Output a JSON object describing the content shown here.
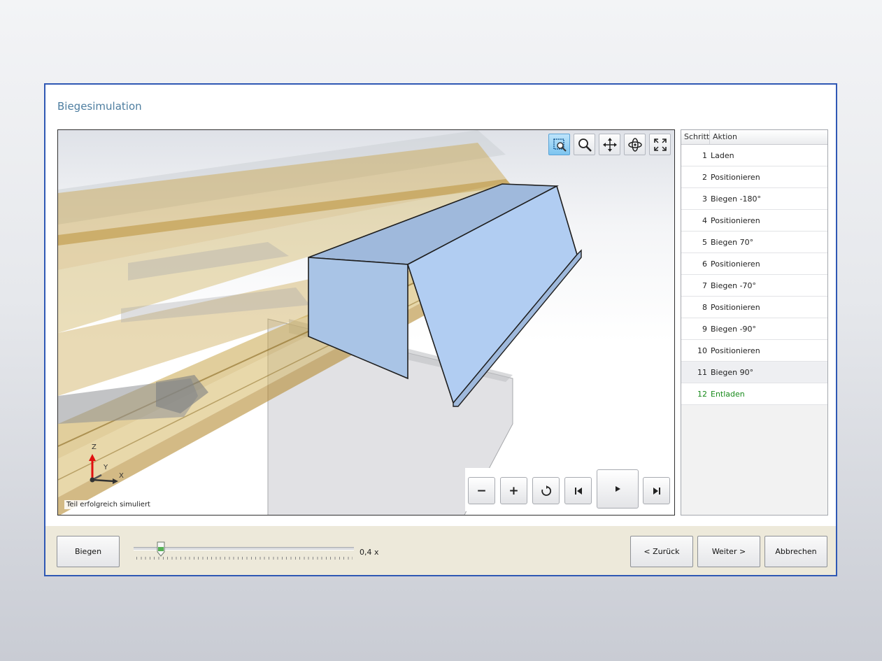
{
  "dialog": {
    "title": "Biegesimulation"
  },
  "viewport": {
    "status": "Teil erfolgreich simuliert",
    "axes": {
      "z": "Z",
      "y": "Y",
      "x": "X"
    },
    "toolbar": [
      {
        "name": "zoom-window-icon",
        "active": true
      },
      {
        "name": "zoom-icon",
        "active": false
      },
      {
        "name": "pan-icon",
        "active": false
      },
      {
        "name": "rotate-icon",
        "active": false
      },
      {
        "name": "fit-to-view-icon",
        "active": false
      }
    ],
    "playback": {
      "zoom_out": "−",
      "zoom_in": "+"
    }
  },
  "steps": {
    "col_step": "Schritt",
    "col_action": "Aktion",
    "selected_step": 11,
    "completed_step": 12,
    "rows": [
      {
        "n": "1",
        "action": "Laden"
      },
      {
        "n": "2",
        "action": "Positionieren"
      },
      {
        "n": "3",
        "action": "Biegen -180°"
      },
      {
        "n": "4",
        "action": "Positionieren"
      },
      {
        "n": "5",
        "action": "Biegen 70°"
      },
      {
        "n": "6",
        "action": "Positionieren"
      },
      {
        "n": "7",
        "action": "Biegen -70°"
      },
      {
        "n": "8",
        "action": "Positionieren"
      },
      {
        "n": "9",
        "action": "Biegen -90°"
      },
      {
        "n": "10",
        "action": "Positionieren"
      },
      {
        "n": "11",
        "action": "Biegen 90°"
      },
      {
        "n": "12",
        "action": "Entladen"
      }
    ]
  },
  "footer": {
    "bend_button": "Biegen",
    "speed_value": "0,4 x",
    "speed_fraction": 0.1,
    "back_button": "< Zurück",
    "next_button": "Weiter >",
    "cancel_button": "Abbrechen"
  },
  "colors": {
    "accent_border": "#2f58b4",
    "title": "#4e7ea0",
    "completed_text": "#178a1a",
    "part_fill": "#a9c8ef",
    "tooling": "#c9a54a"
  }
}
